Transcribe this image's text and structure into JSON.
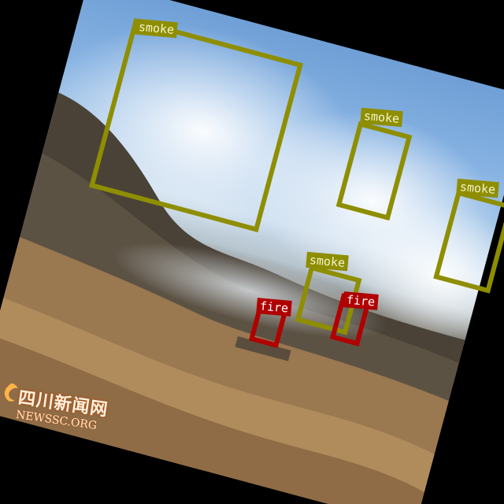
{
  "detections": [
    {
      "label": "smoke",
      "kind": "smoke"
    },
    {
      "label": "smoke",
      "kind": "smoke"
    },
    {
      "label": "smoke",
      "kind": "smoke"
    },
    {
      "label": "smoke",
      "kind": "smoke"
    },
    {
      "label": "fire",
      "kind": "fire"
    },
    {
      "label": "fire",
      "kind": "fire"
    }
  ],
  "watermark": {
    "name": "四川新闻网",
    "site": "NEWSSC.ORG"
  },
  "colors": {
    "smoke_box": "#8e8e00",
    "fire_box": "#b00000"
  }
}
